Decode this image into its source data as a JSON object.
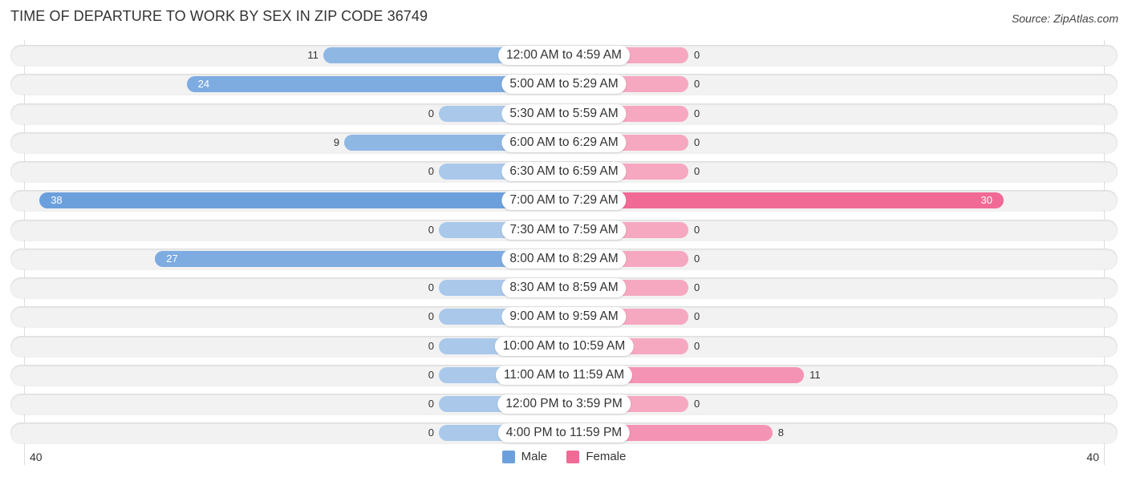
{
  "title": "TIME OF DEPARTURE TO WORK BY SEX IN ZIP CODE 36749",
  "source": "Source: ZipAtlas.com",
  "colors": {
    "male": "#6ca0dc",
    "female": "#f06a95",
    "male_light": "#a9c8ea",
    "female_light": "#f6a8c1"
  },
  "chart_data": {
    "type": "bar",
    "orientation": "horizontal-diverging",
    "title": "TIME OF DEPARTURE TO WORK BY SEX IN ZIP CODE 36749",
    "categories": [
      "12:00 AM to 4:59 AM",
      "5:00 AM to 5:29 AM",
      "5:30 AM to 5:59 AM",
      "6:00 AM to 6:29 AM",
      "6:30 AM to 6:59 AM",
      "7:00 AM to 7:29 AM",
      "7:30 AM to 7:59 AM",
      "8:00 AM to 8:29 AM",
      "8:30 AM to 8:59 AM",
      "9:00 AM to 9:59 AM",
      "10:00 AM to 10:59 AM",
      "11:00 AM to 11:59 AM",
      "12:00 PM to 3:59 PM",
      "4:00 PM to 11:59 PM"
    ],
    "series": [
      {
        "name": "Male",
        "values": [
          11,
          24,
          0,
          9,
          0,
          38,
          0,
          27,
          0,
          0,
          0,
          0,
          0,
          0
        ]
      },
      {
        "name": "Female",
        "values": [
          0,
          0,
          0,
          0,
          0,
          30,
          0,
          0,
          0,
          0,
          0,
          11,
          0,
          8
        ]
      }
    ],
    "axis": {
      "min_label": "40",
      "max_label": "40",
      "range": [
        -40,
        40
      ]
    },
    "legend": {
      "position": "bottom-center",
      "entries": [
        "Male",
        "Female"
      ]
    },
    "grid": false
  }
}
